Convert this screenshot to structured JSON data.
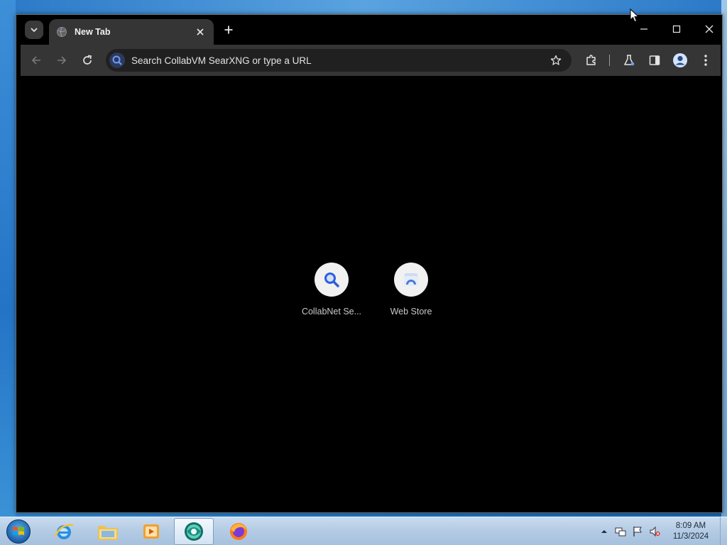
{
  "browser": {
    "tab": {
      "title": "New Tab"
    },
    "omnibox": {
      "placeholder": "Search CollabVM SearXNG or type a URL"
    },
    "shortcuts": [
      {
        "label": "CollabNet Se...",
        "icon": "search-icon"
      },
      {
        "label": "Web Store",
        "icon": "web-store-icon"
      }
    ]
  },
  "taskbar": {
    "apps": [
      "internet-explorer-icon",
      "file-explorer-icon",
      "media-player-icon",
      "browser-icon",
      "firefox-icon"
    ],
    "clock": {
      "time": "8:09 AM",
      "date": "11/3/2024"
    }
  },
  "colors": {
    "toolbar": "#353535",
    "content": "#000000",
    "omnibox": "#202020",
    "accent": "#4a7bd8",
    "taskbar": "#b3cbe4"
  }
}
